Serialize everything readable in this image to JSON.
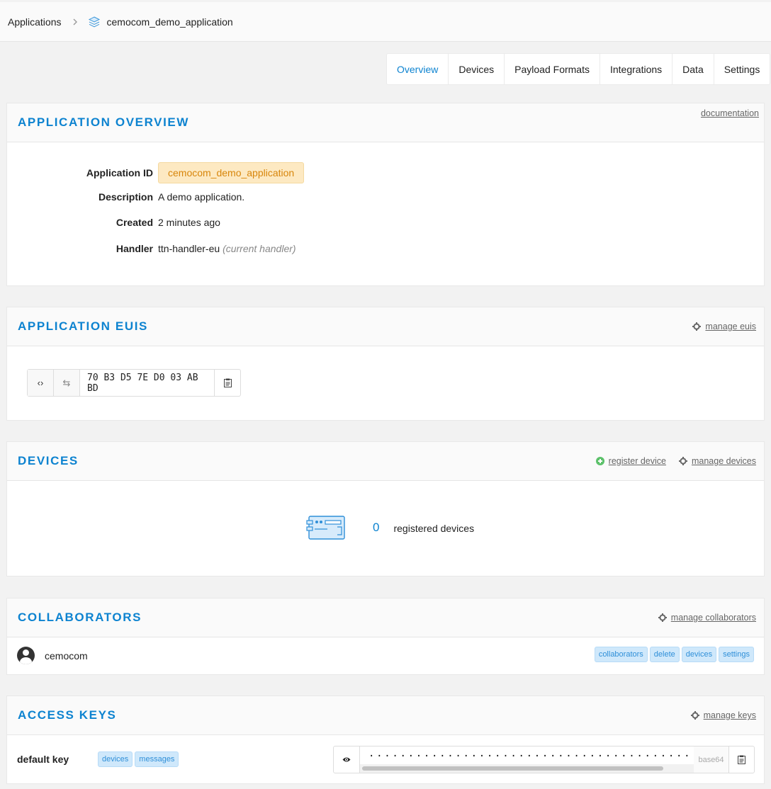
{
  "breadcrumb": {
    "root": "Applications",
    "separator": ">",
    "current": "cemocom_demo_application",
    "icon": "layers-icon"
  },
  "tabs": [
    "Overview",
    "Devices",
    "Payload Formats",
    "Integrations",
    "Data",
    "Settings"
  ],
  "active_tab": "Overview",
  "overview": {
    "title": "APPLICATION OVERVIEW",
    "doc_link": "documentation",
    "app_id_label": "Application ID",
    "app_id": "cemocom_demo_application",
    "description_label": "Description",
    "description": "A demo application.",
    "created_label": "Created",
    "created": "2 minutes ago",
    "handler_label": "Handler",
    "handler": "ttn-handler-eu",
    "handler_note": "(current handler)"
  },
  "euis": {
    "title": "APPLICATION EUIS",
    "manage_link": "manage euis",
    "toggle_glyph": "‹›",
    "swap_glyph": "⇆",
    "eui": "70 B3 D5 7E D0 03 AB BD"
  },
  "devices": {
    "title": "DEVICES",
    "register_link": "register device",
    "manage_link": "manage devices",
    "count": "0",
    "count_label": "registered devices"
  },
  "collaborators": {
    "title": "COLLABORATORS",
    "manage_link": "manage collaborators",
    "users": [
      {
        "name": "cemocom",
        "rights": [
          "collaborators",
          "delete",
          "devices",
          "settings"
        ]
      }
    ]
  },
  "access_keys": {
    "title": "ACCESS KEYS",
    "manage_link": "manage keys",
    "keys": [
      {
        "name": "default key",
        "rights": [
          "devices",
          "messages"
        ],
        "masked": "··································································",
        "encoding": "base64"
      }
    ]
  },
  "colors": {
    "accent": "#0d83d0",
    "appid_bg": "#fde9c2",
    "appid_text": "#d8860b",
    "badge_bg": "#cfe8fb",
    "plus_green": "#5cc16a"
  }
}
